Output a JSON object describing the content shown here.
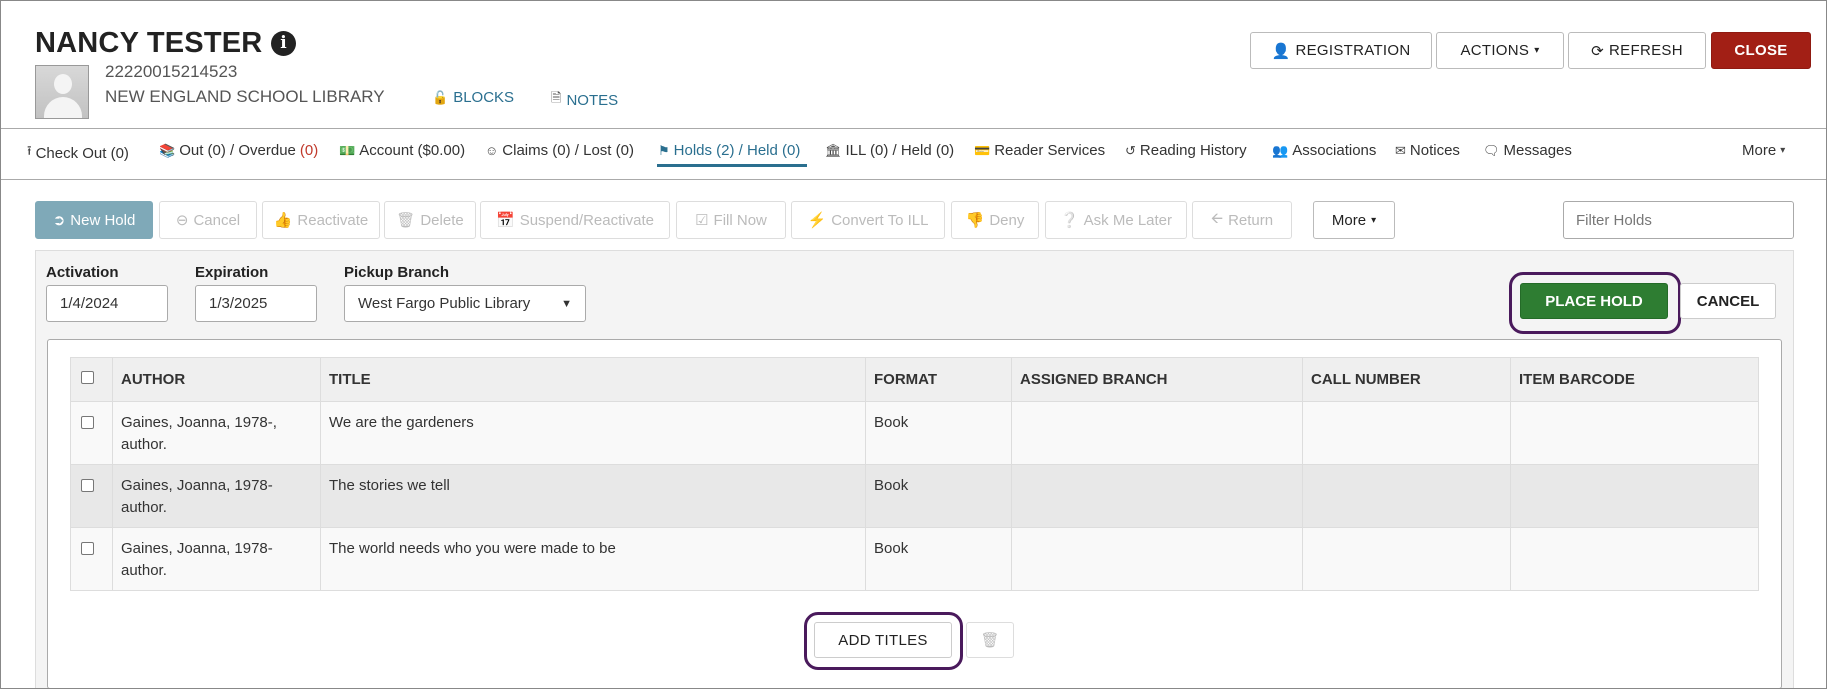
{
  "patron": {
    "name": "NANCY TESTER",
    "barcode": "22220015214523",
    "library": "NEW ENGLAND SCHOOL LIBRARY",
    "blocks_label": "BLOCKS",
    "notes_label": "NOTES"
  },
  "header_buttons": {
    "registration": "REGISTRATION",
    "actions": "ACTIONS",
    "refresh": "REFRESH",
    "close": "CLOSE"
  },
  "tabs": [
    {
      "label": "Check Out (0)",
      "icon": "upload-icon"
    },
    {
      "label": "Out (0) / Overdue ",
      "extra": "(0)",
      "icon": "books-icon"
    },
    {
      "label": "Account ($0.00)",
      "icon": "money-icon"
    },
    {
      "label": "Claims (0) / Lost (0)",
      "icon": "smile-icon"
    },
    {
      "label": "Holds (2) / Held (0)",
      "icon": "flag-icon"
    },
    {
      "label": "ILL (0) / Held (0)",
      "icon": "library-icon"
    },
    {
      "label": "Reader Services",
      "icon": "id-card-icon"
    },
    {
      "label": "Reading History",
      "icon": "history-icon"
    },
    {
      "label": "Associations",
      "icon": "users-icon"
    },
    {
      "label": "Notices",
      "icon": "envelope-icon"
    },
    {
      "label": "Messages",
      "icon": "comment-icon"
    },
    {
      "label": "More",
      "icon": "caret-down-icon"
    }
  ],
  "toolbar": {
    "new_hold": "New Hold",
    "cancel": "Cancel",
    "reactivate": "Reactivate",
    "delete": "Delete",
    "suspend": "Suspend/Reactivate",
    "fill_now": "Fill Now",
    "convert_ill": "Convert To ILL",
    "deny": "Deny",
    "ask_later": "Ask Me Later",
    "return": "Return",
    "more": "More",
    "filter_placeholder": "Filter Holds"
  },
  "form": {
    "activation_label": "Activation",
    "activation_value": "1/4/2024",
    "expiration_label": "Expiration",
    "expiration_value": "1/3/2025",
    "pickup_label": "Pickup Branch",
    "pickup_value": "West Fargo Public Library",
    "place_hold": "PLACE HOLD",
    "cancel": "CANCEL",
    "add_titles": "ADD TITLES"
  },
  "table": {
    "headers": [
      "AUTHOR",
      "TITLE",
      "FORMAT",
      "ASSIGNED BRANCH",
      "CALL NUMBER",
      "ITEM BARCODE"
    ],
    "rows": [
      {
        "author": "Gaines, Joanna, 1978-, author.",
        "title": "We are the gardeners",
        "format": "Book",
        "branch": "",
        "call_number": "",
        "item_barcode": ""
      },
      {
        "author": "Gaines, Joanna, 1978- author.",
        "title": "The stories we tell",
        "format": "Book",
        "branch": "",
        "call_number": "",
        "item_barcode": ""
      },
      {
        "author": "Gaines, Joanna, 1978- author.",
        "title": "The world needs who you were made to be",
        "format": "Book",
        "branch": "",
        "call_number": "",
        "item_barcode": ""
      }
    ]
  },
  "colors": {
    "accent": "#2a6f8f",
    "close": "#a21f15",
    "place_hold": "#2e7d32",
    "highlight_ring": "#4a1a5c"
  }
}
